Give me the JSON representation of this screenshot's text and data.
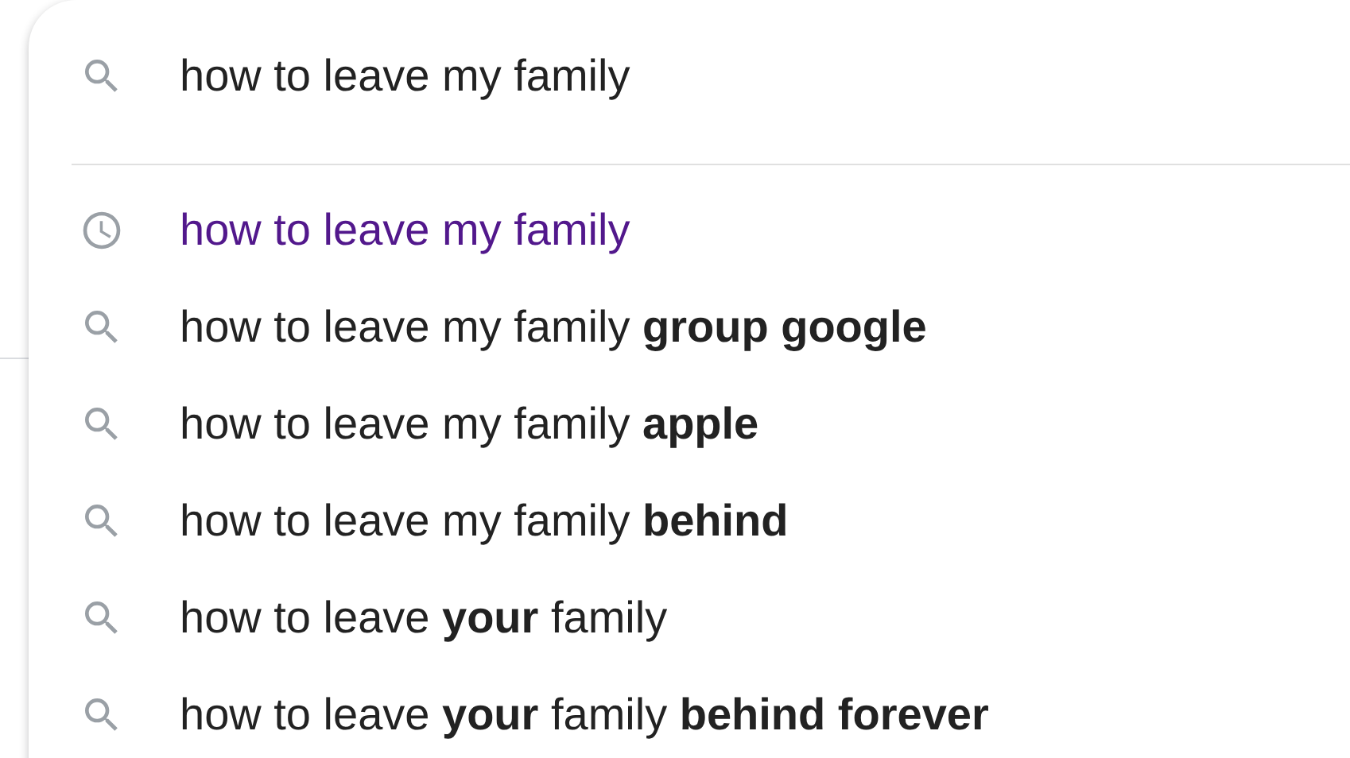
{
  "search": {
    "value": "how to leave my family"
  },
  "suggestions": [
    {
      "kind": "history",
      "text": "how to leave my family"
    },
    {
      "kind": "search",
      "text": "how to leave my family **group google**"
    },
    {
      "kind": "search",
      "text": "how to leave my family **apple**"
    },
    {
      "kind": "search",
      "text": "how to leave my family **behind**"
    },
    {
      "kind": "search",
      "text": "how to leave **your** family"
    },
    {
      "kind": "search",
      "text": "how to leave **your** family **behind forever**"
    }
  ]
}
